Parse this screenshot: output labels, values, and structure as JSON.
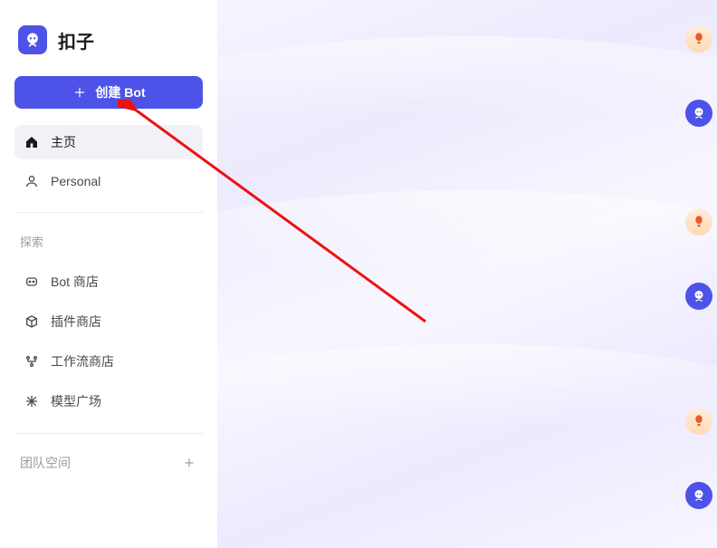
{
  "brand": {
    "name": "扣子",
    "logo_icon": "coze-logo"
  },
  "create_button": {
    "label": "创建 Bot"
  },
  "nav": {
    "home": {
      "label": "主页",
      "icon": "home-icon"
    },
    "personal": {
      "label": "Personal",
      "icon": "user-icon"
    }
  },
  "explore": {
    "section_label": "探索",
    "items": [
      {
        "label": "Bot 商店",
        "icon": "bot-store-icon"
      },
      {
        "label": "插件商店",
        "icon": "plugin-store-icon"
      },
      {
        "label": "工作流商店",
        "icon": "workflow-store-icon"
      },
      {
        "label": "模型广场",
        "icon": "model-square-icon"
      }
    ]
  },
  "team": {
    "section_label": "团队空间",
    "add_icon": "plus-icon"
  },
  "right_dock": {
    "items": [
      {
        "name": "avatar-balloon-1",
        "type": "balloon"
      },
      {
        "name": "avatar-bot-1",
        "type": "bot"
      },
      {
        "name": "avatar-balloon-2",
        "type": "balloon"
      },
      {
        "name": "avatar-bot-2",
        "type": "bot"
      },
      {
        "name": "avatar-balloon-3",
        "type": "balloon"
      },
      {
        "name": "avatar-bot-3",
        "type": "bot"
      }
    ]
  },
  "annotation": {
    "name": "pointer-arrow-to-create-bot"
  },
  "colors": {
    "accent": "#4d53e8"
  }
}
